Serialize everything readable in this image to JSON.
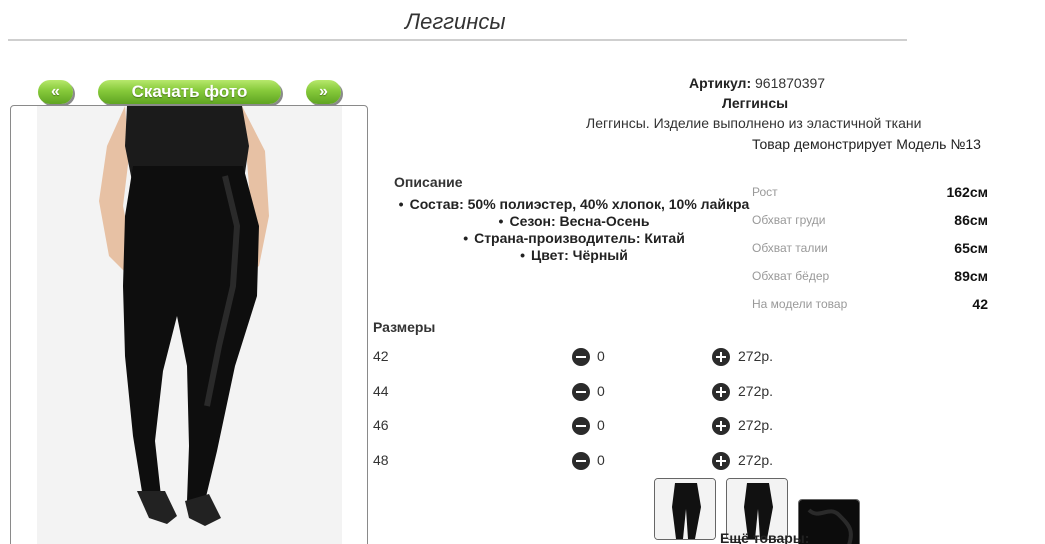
{
  "page": {
    "title": "Леггинсы"
  },
  "gallery": {
    "prev_label": "«",
    "download_label": "Скачать фото",
    "next_label": "»",
    "accent_color": "#7cc23a"
  },
  "product": {
    "article_label": "Артикул:",
    "article_value": "961870397",
    "name": "Леггинсы",
    "description": "Леггинсы. Изделие выполнено из эластичной ткани",
    "model_note": "Товар демонстрирует Модель №13"
  },
  "details": {
    "title": "Описание",
    "items": [
      "Состав: 50% полиэстер, 40% хлопок, 10% лайкра",
      "Сезон: Весна-Осень",
      "Страна-производитель: Китай",
      "Цвет: Чёрный"
    ]
  },
  "model_params": [
    {
      "label": "Рост",
      "value": "162см"
    },
    {
      "label": "Обхват груди",
      "value": "86см"
    },
    {
      "label": "Обхват талии",
      "value": "65см"
    },
    {
      "label": "Обхват бёдер",
      "value": "89см"
    },
    {
      "label": "На модели товар",
      "value": "42"
    }
  ],
  "sizes": {
    "title": "Размеры",
    "rows": [
      {
        "size": "42",
        "qty": "0",
        "price": "272р."
      },
      {
        "size": "44",
        "qty": "0",
        "price": "272р."
      },
      {
        "size": "46",
        "qty": "0",
        "price": "272р."
      },
      {
        "size": "48",
        "qty": "0",
        "price": "272р."
      }
    ]
  },
  "more_goods_label": "Ещё товары:"
}
